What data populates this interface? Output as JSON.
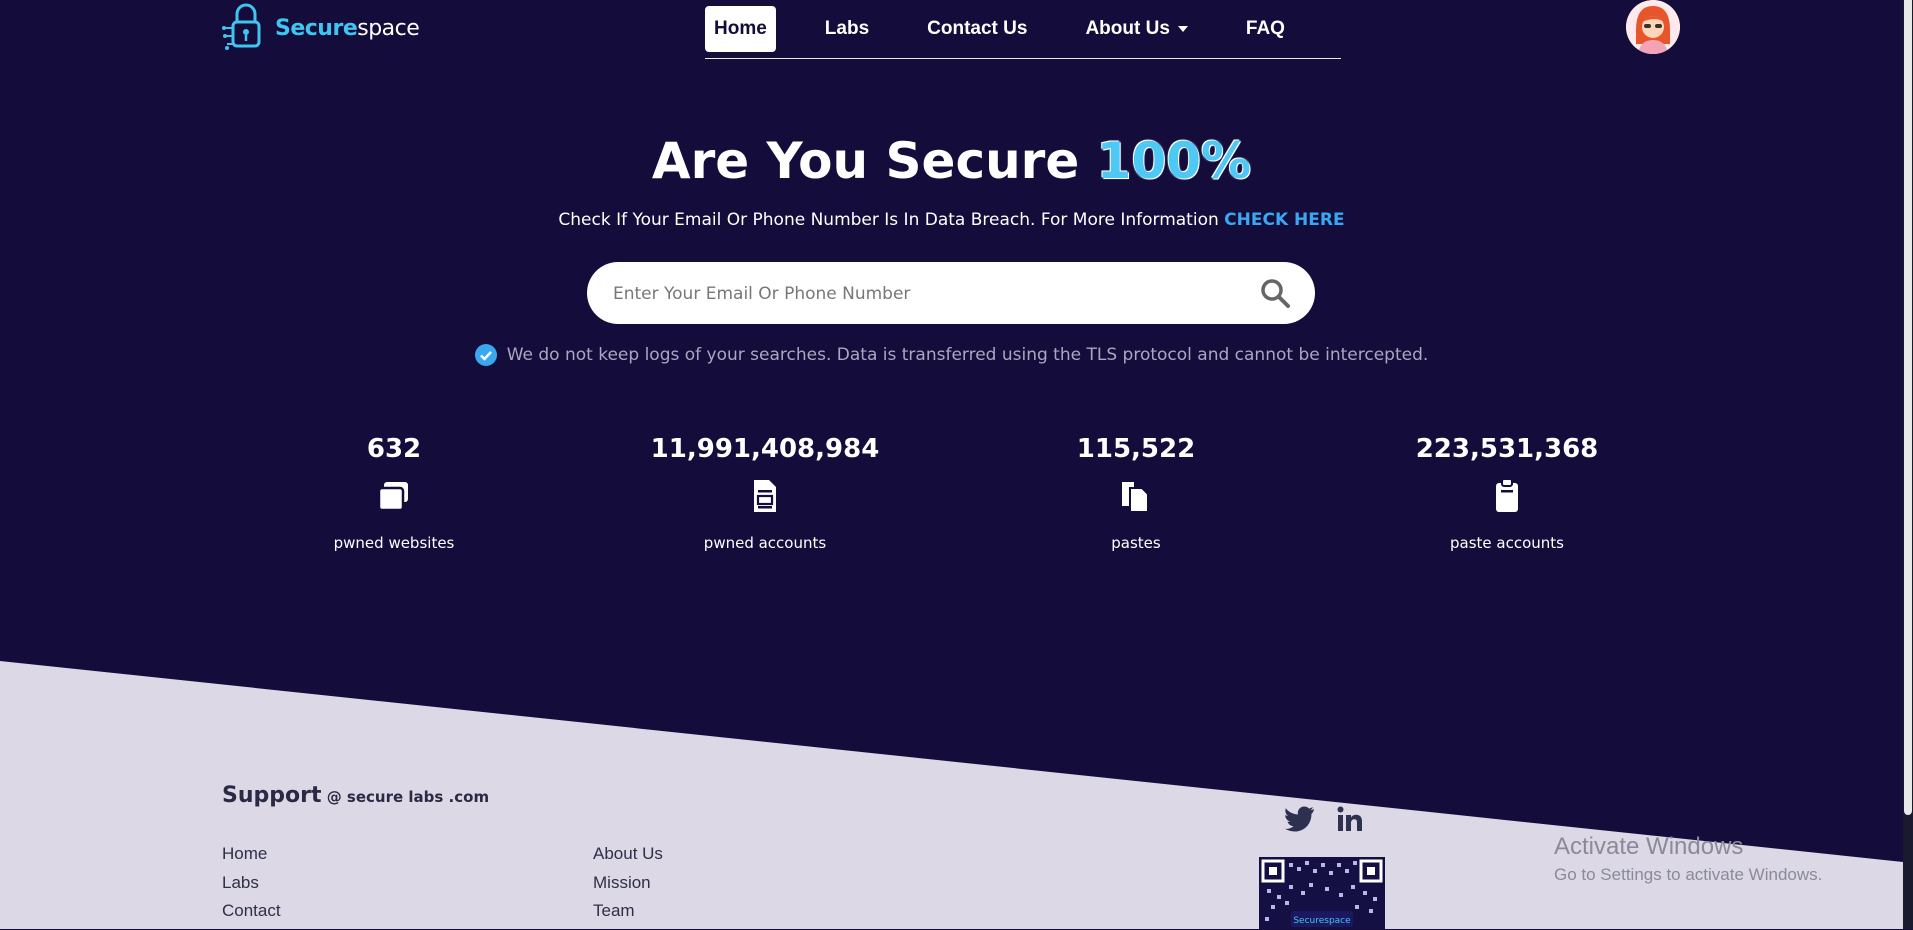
{
  "header": {
    "logo": {
      "brand_a": "Secure",
      "brand_b": "space"
    },
    "nav": [
      {
        "label": "Home",
        "active": true
      },
      {
        "label": "Labs"
      },
      {
        "label": "Contact Us"
      },
      {
        "label": "About Us",
        "dropdown": true
      },
      {
        "label": "FAQ"
      }
    ]
  },
  "hero": {
    "title": "Are You Secure ",
    "title_highlight": "100%",
    "subtitle": "Check If Your Email Or Phone Number Is In Data Breach. For More Information ",
    "subtitle_link": "CHECK HERE",
    "search_placeholder": "Enter Your Email Or Phone Number",
    "privacy_note": "We do not keep logs of your searches. Data is transferred using the TLS protocol and cannot be intercepted."
  },
  "stats": [
    {
      "value": "632",
      "label": "pwned websites",
      "icon": "websites-icon"
    },
    {
      "value": "11,991,408,984",
      "label": "pwned accounts",
      "icon": "document-icon"
    },
    {
      "value": "115,522",
      "label": "pastes",
      "icon": "pastes-icon"
    },
    {
      "value": "223,531,368",
      "label": "paste accounts",
      "icon": "clipboard-icon"
    }
  ],
  "footer": {
    "support_big": "Support",
    "support_small": " @ secure labs .com",
    "links_col1": [
      "Home",
      "Labs",
      "Contact"
    ],
    "links_col2": [
      "About Us",
      "Mission",
      "Team"
    ],
    "qr_label": "Securespace"
  },
  "overlay": {
    "activate_title": "Activate Windows",
    "activate_sub": "Go to Settings to activate Windows."
  },
  "colors": {
    "background": "#140c3b",
    "footer": "#dcd8e6",
    "accent": "#4ec8f4",
    "link": "#3aa8f0"
  }
}
